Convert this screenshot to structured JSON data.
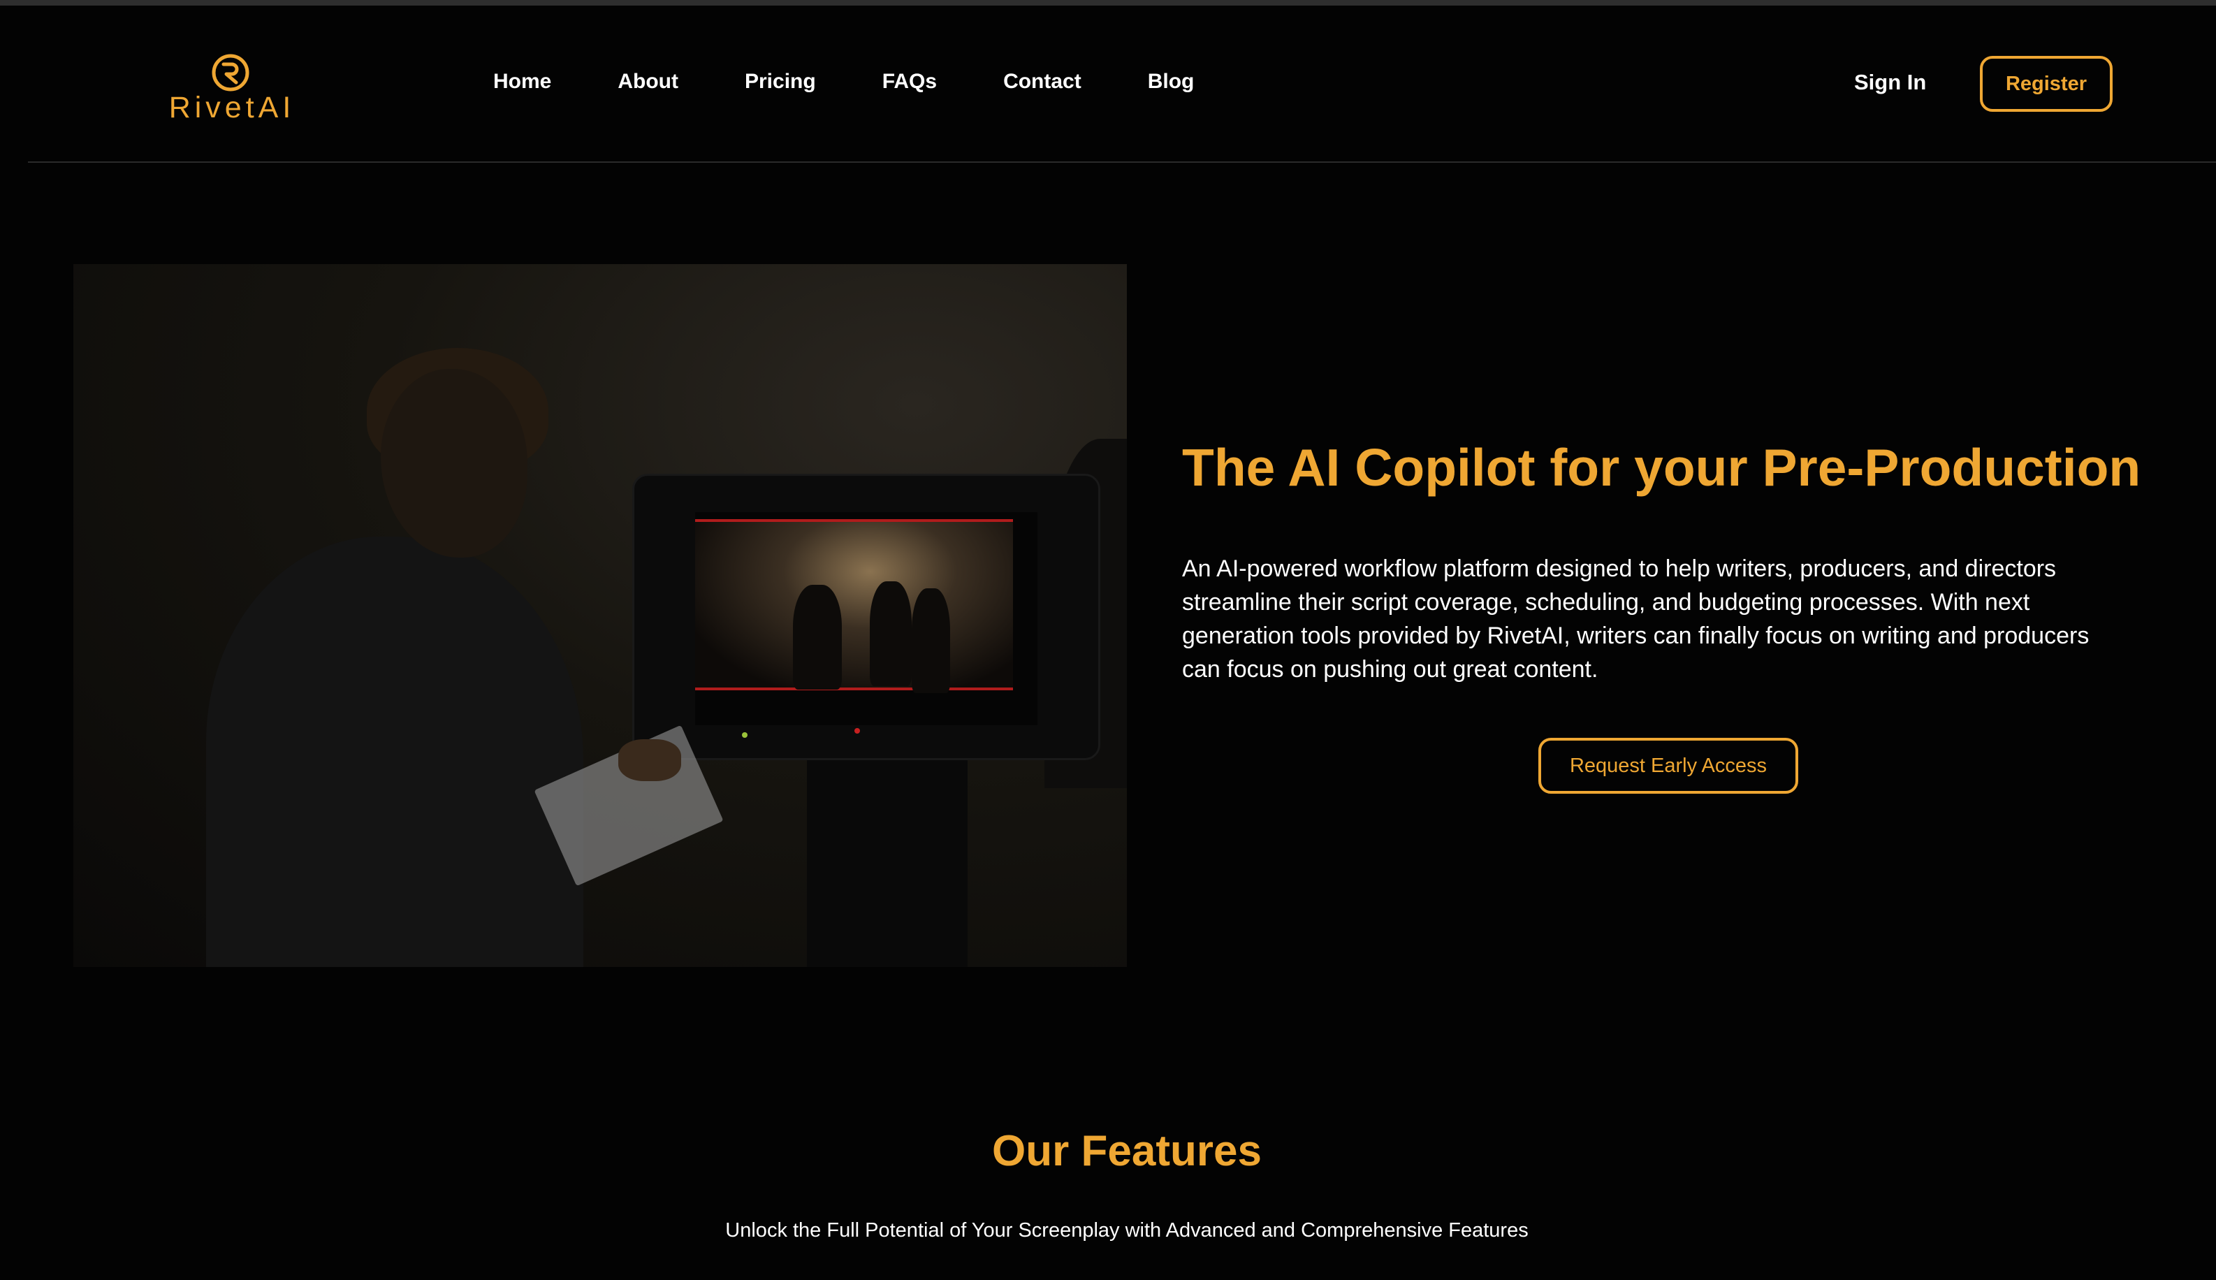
{
  "brand": {
    "name": "RivetAI",
    "accent_color": "#efa733",
    "logo_icon": "rivetai-logo-mark"
  },
  "nav": {
    "items": [
      {
        "label": "Home"
      },
      {
        "label": "About"
      },
      {
        "label": "Pricing"
      },
      {
        "label": "FAQs"
      },
      {
        "label": "Contact"
      },
      {
        "label": "Blog"
      }
    ],
    "sign_in_label": "Sign In",
    "register_label": "Register"
  },
  "hero": {
    "title": "The AI Copilot for your Pre-Production",
    "description": "An AI-powered workflow platform designed to help writers, producers, and directors streamline their script coverage, scheduling, and budgeting processes. With next generation tools provided by RivetAI, writers can finally focus on writing and producers can focus on pushing out great content.",
    "cta_label": "Request Early Access"
  },
  "features": {
    "title": "Our Features",
    "subtitle": "Unlock the Full Potential of Your Screenplay with Advanced and Comprehensive Features"
  }
}
